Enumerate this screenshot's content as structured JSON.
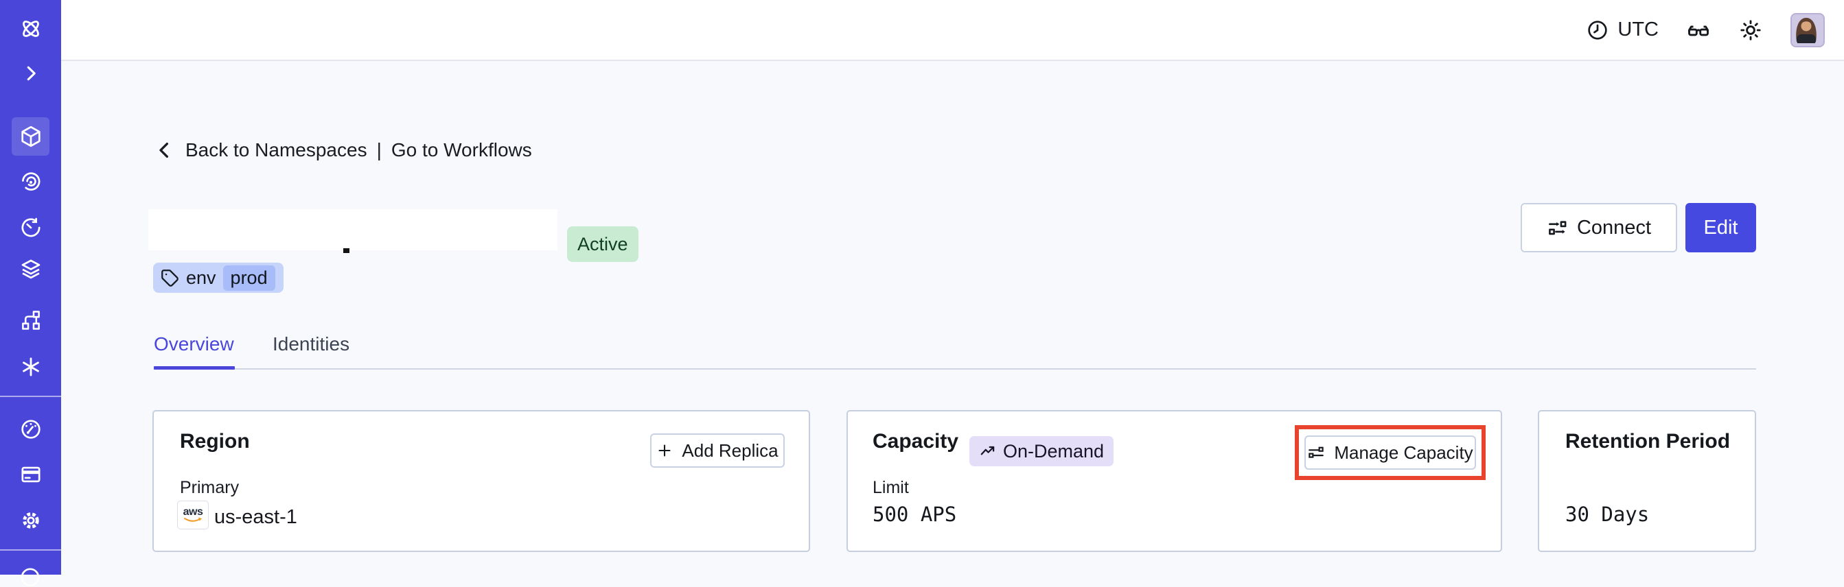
{
  "topbar": {
    "timezone": "UTC",
    "icons": [
      "clock",
      "reading-glasses",
      "sun-theme",
      "avatar"
    ]
  },
  "sidebar": {
    "icons": [
      "temporal-logo",
      "chevron-right-expand",
      "cube-namespaces",
      "spiral",
      "timer",
      "layers",
      "branch",
      "asterisk",
      "gauge",
      "credit-card",
      "gear",
      "partial-bottom"
    ],
    "active_icon": "cube-namespaces"
  },
  "breadcrumb": {
    "back_label": "Back to Namespaces",
    "separator": "|",
    "forward_label": "Go to Workflows"
  },
  "namespace_header": {
    "status_badge": "Active",
    "tag_key": "env",
    "tag_value": "prod",
    "connect_label": "Connect",
    "edit_label": "Edit"
  },
  "tabs": [
    {
      "label": "Overview",
      "active": true
    },
    {
      "label": "Identities",
      "active": false
    }
  ],
  "cards": {
    "region": {
      "title": "Region",
      "add_replica_label": "Add Replica",
      "primary_label": "Primary",
      "provider": "aws",
      "region_value": "us-east-1"
    },
    "capacity": {
      "title": "Capacity",
      "badge": "On-Demand",
      "limit_label": "Limit",
      "limit_value": "500 APS",
      "manage_label": "Manage Capacity"
    },
    "retention": {
      "title": "Retention Period",
      "value": "30 Days"
    }
  },
  "colors": {
    "sidebar_indigo": "#4946d9",
    "accent_indigo": "#4649e0",
    "active_badge_bg": "#c8ebd2",
    "active_badge_text": "#103f23",
    "tag_bg": "#c6d4fb",
    "tag_chip_bg": "#a7bcf8",
    "ondemand_bg": "#e5def9",
    "highlight_red": "#e8432d",
    "aws_orange": "#f49a25",
    "content_bg": "#f8f9fc"
  }
}
